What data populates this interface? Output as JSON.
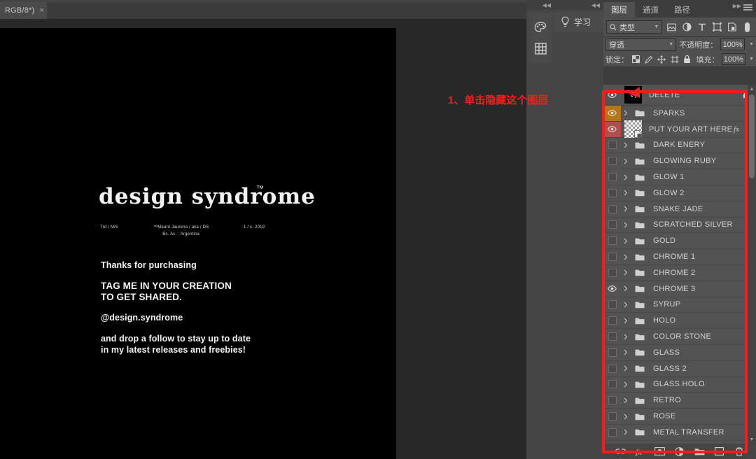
{
  "document": {
    "tab_title": "RGB/8*)",
    "close_label": "×"
  },
  "annotation": {
    "text": "1、单击隐藏这个图层",
    "color": "#ff1a1a"
  },
  "artwork": {
    "logo": "design syndrome",
    "logo_tm": "™",
    "fine_left": "Trd / Mrk",
    "fine_center": "™Mauro Jaurena / aka  / DS\nBs. As. ; Argentina",
    "fine_right": "1 / c. 2019",
    "line1": "Thanks for purchasing",
    "line2": "TAG ME IN YOUR CREATION\nTO GET SHARED.",
    "line3": "@design.syndrome",
    "line4": "and drop a follow to stay up to date\nin my latest releases and freebies!"
  },
  "dock": {
    "buttons": [
      {
        "name": "color-palette-icon"
      },
      {
        "name": "grid-icon"
      }
    ]
  },
  "learn_panel": {
    "label": "学习",
    "icon": "lightbulb-icon"
  },
  "layers_panel": {
    "tabs": [
      {
        "label": "图层",
        "active": true
      },
      {
        "label": "通道",
        "active": false
      },
      {
        "label": "路径",
        "active": false
      }
    ],
    "filter": {
      "kind_value": "类型",
      "icons": [
        "pixel-layer-filter-icon",
        "adjustment-layer-filter-icon",
        "type-layer-filter-icon",
        "shape-layer-filter-icon",
        "smart-object-filter-icon",
        "filter-toggle-icon"
      ]
    },
    "blend": {
      "mode": "穿透",
      "opacity_label": "不透明度：",
      "opacity_value": "100%"
    },
    "lock": {
      "label": "锁定：",
      "icons": [
        "lock-transparency-icon",
        "lock-image-icon",
        "lock-position-icon",
        "lock-artboard-icon",
        "lock-all-icon"
      ],
      "fill_label": "填充：",
      "fill_value": "100%"
    },
    "layers": [
      {
        "name": "DELETE",
        "visible": true,
        "type": "image",
        "tall": true,
        "locked": true,
        "highlight": "none"
      },
      {
        "name": "SPARKS",
        "visible": true,
        "type": "group",
        "highlight": "orange"
      },
      {
        "name": "PUT YOUR ART HERE",
        "visible": true,
        "type": "smart",
        "highlight": "red",
        "fx": "fx"
      },
      {
        "name": "DARK ENERY",
        "visible": false,
        "type": "group",
        "highlight": "none"
      },
      {
        "name": "GLOWING RUBY",
        "visible": false,
        "type": "group",
        "highlight": "none"
      },
      {
        "name": "GLOW 1",
        "visible": false,
        "type": "group",
        "highlight": "none"
      },
      {
        "name": "GLOW 2",
        "visible": false,
        "type": "group",
        "highlight": "none"
      },
      {
        "name": "SNAKE JADE",
        "visible": false,
        "type": "group",
        "highlight": "none"
      },
      {
        "name": "SCRATCHED SILVER",
        "visible": false,
        "type": "group",
        "highlight": "none"
      },
      {
        "name": "GOLD",
        "visible": false,
        "type": "group",
        "highlight": "none"
      },
      {
        "name": "CHROME 1",
        "visible": false,
        "type": "group",
        "highlight": "none"
      },
      {
        "name": "CHROME 2",
        "visible": false,
        "type": "group",
        "highlight": "none"
      },
      {
        "name": "CHROME 3",
        "visible": true,
        "type": "group",
        "highlight": "none"
      },
      {
        "name": "SYRUP",
        "visible": false,
        "type": "group",
        "highlight": "none"
      },
      {
        "name": "HOLO",
        "visible": false,
        "type": "group",
        "highlight": "none"
      },
      {
        "name": "COLOR STONE",
        "visible": false,
        "type": "group",
        "highlight": "none"
      },
      {
        "name": "GLASS",
        "visible": false,
        "type": "group",
        "highlight": "none"
      },
      {
        "name": "GLASS 2",
        "visible": false,
        "type": "group",
        "highlight": "none"
      },
      {
        "name": "GLASS HOLO",
        "visible": false,
        "type": "group",
        "highlight": "none"
      },
      {
        "name": "RETRO",
        "visible": false,
        "type": "group",
        "highlight": "none"
      },
      {
        "name": "ROSE",
        "visible": false,
        "type": "group",
        "highlight": "none"
      },
      {
        "name": "METAL TRANSFER",
        "visible": false,
        "type": "group",
        "highlight": "none"
      }
    ],
    "footer_buttons": [
      {
        "name": "link-layers-icon"
      },
      {
        "name": "layer-style-fx-icon"
      },
      {
        "name": "add-layer-mask-icon"
      },
      {
        "name": "new-adjustment-layer-icon"
      },
      {
        "name": "new-group-icon"
      },
      {
        "name": "new-layer-icon"
      },
      {
        "name": "delete-layer-icon"
      }
    ]
  }
}
